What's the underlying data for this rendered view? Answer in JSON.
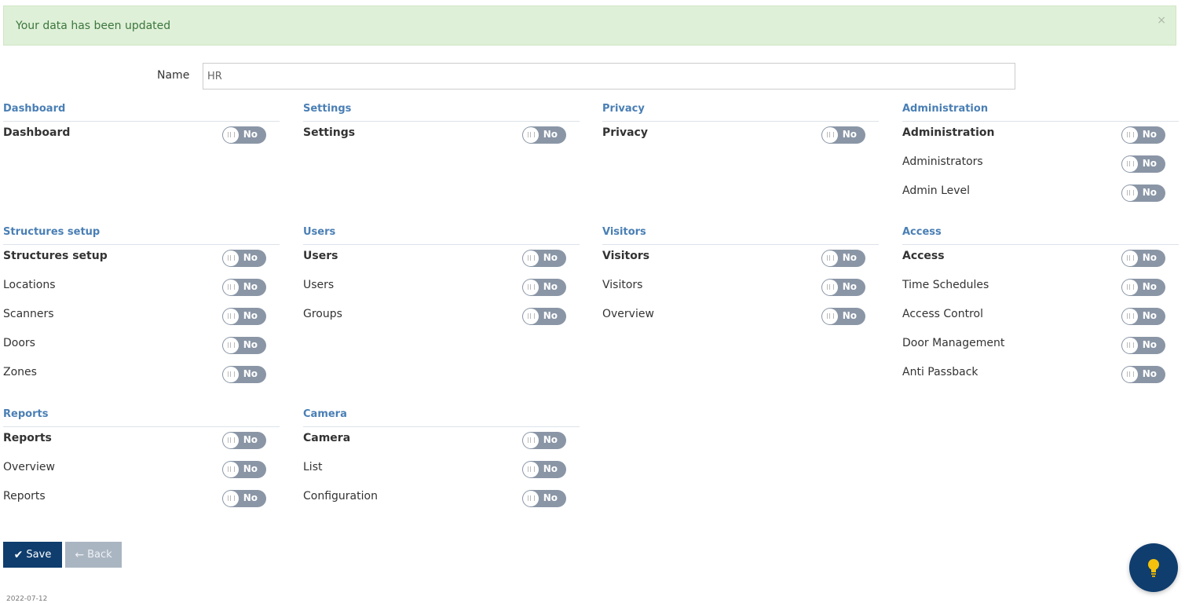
{
  "alert": {
    "message": "Your data has been updated",
    "close": "×"
  },
  "form": {
    "name_label": "Name",
    "name_value": "HR"
  },
  "toggle_off_label": "No",
  "sections": {
    "dashboard": {
      "title": "Dashboard",
      "rows": [
        "Dashboard"
      ]
    },
    "settings": {
      "title": "Settings",
      "rows": [
        "Settings"
      ]
    },
    "privacy": {
      "title": "Privacy",
      "rows": [
        "Privacy"
      ]
    },
    "administration": {
      "title": "Administration",
      "rows": [
        "Administration",
        "Administrators",
        "Admin Level"
      ]
    },
    "structures": {
      "title": "Structures setup",
      "rows": [
        "Structures setup",
        "Locations",
        "Scanners",
        "Doors",
        "Zones"
      ]
    },
    "users": {
      "title": "Users",
      "rows": [
        "Users",
        "Users",
        "Groups"
      ]
    },
    "visitors": {
      "title": "Visitors",
      "rows": [
        "Visitors",
        "Visitors",
        "Overview"
      ]
    },
    "access": {
      "title": "Access",
      "rows": [
        "Access",
        "Time Schedules",
        "Access Control",
        "Door Management",
        "Anti Passback"
      ]
    },
    "reports": {
      "title": "Reports",
      "rows": [
        "Reports",
        "Overview",
        "Reports"
      ]
    },
    "camera": {
      "title": "Camera",
      "rows": [
        "Camera",
        "List",
        "Configuration"
      ]
    }
  },
  "buttons": {
    "save": "Save",
    "back": "Back"
  },
  "footer": {
    "date": "2022-07-12"
  },
  "colors": {
    "primary": "#0f3d6e",
    "section_title": "#4a7fb5",
    "toggle_off": "#8a96a6",
    "alert_bg": "#dff0d8"
  },
  "icons": {
    "save": "check-icon",
    "back": "arrow-left-icon",
    "help": "lightbulb-icon"
  }
}
